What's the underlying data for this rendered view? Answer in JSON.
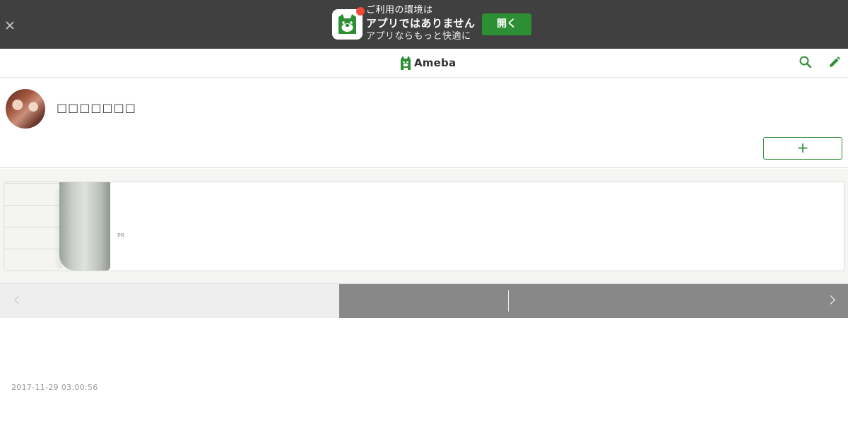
{
  "app_banner": {
    "line1": "ご利用の環境は",
    "line2": "アプリではありません",
    "line3": "アプリならもっと快適に",
    "open_label": "開く",
    "accent_color": "#2d8f34",
    "badge_color": "#ef4b3b"
  },
  "header": {
    "logo_text": "Ameba",
    "icons": [
      "search-icon",
      "pencil-icon"
    ]
  },
  "profile": {
    "blog_title": "□□□□□□□",
    "follow_label": "+"
  },
  "ad": {
    "label": "PR"
  },
  "pager": {
    "prev_icon": "chevron-left-icon",
    "next_icon": "chevron-right-icon"
  },
  "entry": {
    "timestamp": "2017-11-29 03:00:56"
  }
}
